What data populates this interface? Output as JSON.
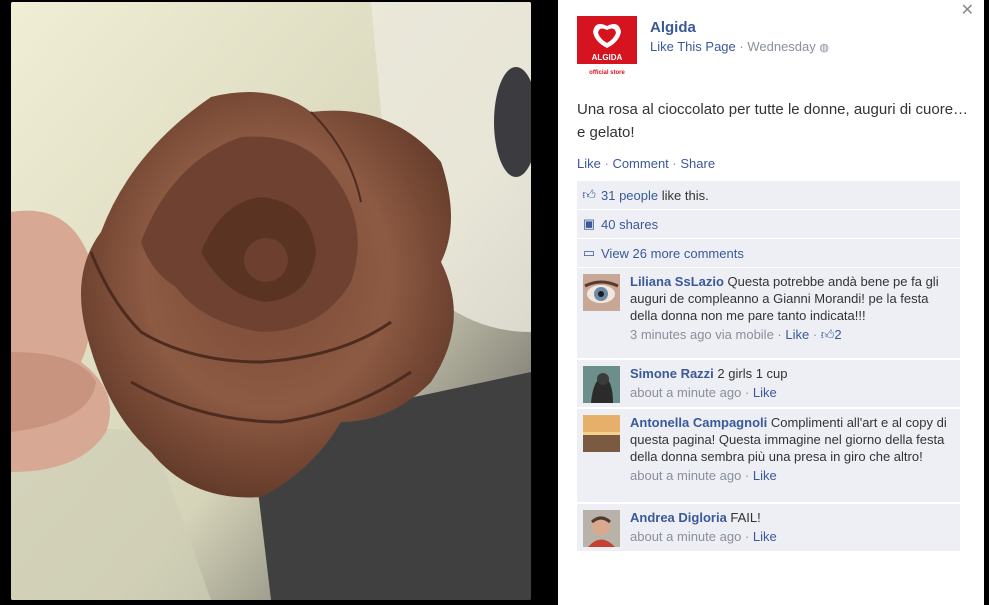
{
  "post": {
    "page_name": "Algida",
    "like_page": "Like This Page",
    "time": "Wednesday",
    "logo_text": "ALGIDA",
    "logo_sub": "official store",
    "text": "Una rosa al cioccolato per tutte le donne, auguri di cuore… e gelato!",
    "actions": {
      "like": "Like",
      "comment": "Comment",
      "share": "Share"
    }
  },
  "summary": {
    "likes": "31 people",
    "likes_suffix": " like this.",
    "shares": "40 shares",
    "more_comments": "View 26 more comments"
  },
  "comments": [
    {
      "author": "Liliana SsLazio",
      "text": " Questa potrebbe andà bene pe fa gli auguri de compleanno a Gianni Morandi! pe la festa della donna non me pare tanto indicata!!!",
      "time": "3 minutes ago via mobile",
      "like": "Like",
      "likes": "2"
    },
    {
      "author": "Simone Razzi",
      "text": " 2 girls 1 cup",
      "time": "about a minute ago",
      "like": "Like"
    },
    {
      "author": "Antonella Campagnoli",
      "text": " Complimenti all'art e al copy di questa pagina! Questa immagine nel giorno della festa della donna sembra più una presa in giro che altro!",
      "time": "about a minute ago",
      "like": "Like"
    },
    {
      "author": "Andrea Digloria",
      "text": " FAIL!",
      "time": "about a minute ago",
      "like": "Like"
    }
  ],
  "colors": {
    "link": "#3b5998",
    "muted": "#898f9c",
    "ufi_bg": "#edeff4",
    "brand_red": "#d6141f"
  },
  "icons": {
    "close": "close-icon",
    "like": "thumbs-up-icon",
    "share": "share-icon",
    "comment": "comment-icon",
    "globe": "globe-icon"
  }
}
